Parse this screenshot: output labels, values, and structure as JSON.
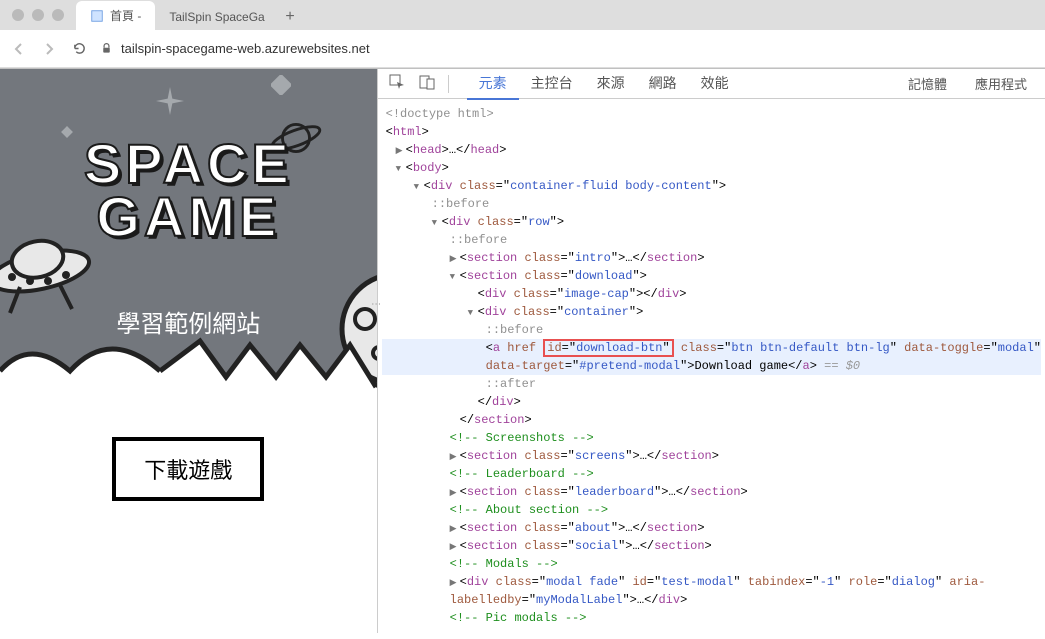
{
  "browser": {
    "tabs": [
      {
        "title": "首頁 -",
        "active": true
      },
      {
        "title": "TailSpin SpaceGa",
        "active": false
      }
    ],
    "url": "tailspin-spacegame-web.azurewebsites.net"
  },
  "page": {
    "title_line1": "SPACE",
    "title_line2": "GAME",
    "subtitle": "學習範例網站",
    "download_button": "下載遊戲"
  },
  "devtools": {
    "tabs": {
      "elements": "元素",
      "console": "主控台",
      "sources": "來源",
      "network": "網路",
      "performance": "效能",
      "memory": "記憶體",
      "application": "應用程式"
    },
    "dom": {
      "doctype": "<!doctype html>",
      "html_open": "html",
      "head": {
        "open": "head",
        "ellipsis": "…",
        "close": "head"
      },
      "body_open": "body",
      "container_div": {
        "tag": "div",
        "class_attr": "class",
        "class_val": "container-fluid body-content"
      },
      "before": "::before",
      "row_div": {
        "tag": "div",
        "class_attr": "class",
        "class_val": "row"
      },
      "intro": {
        "tag": "section",
        "class_attr": "class",
        "class_val": "intro",
        "ellipsis": "…"
      },
      "download": {
        "tag": "section",
        "class_attr": "class",
        "class_val": "download"
      },
      "image_cap": {
        "tag": "div",
        "class_attr": "class",
        "class_val": "image-cap"
      },
      "container": {
        "tag": "div",
        "class_attr": "class",
        "class_val": "container"
      },
      "anchor": {
        "tag": "a",
        "href_attr": "href",
        "id_attr": "id",
        "id_val": "download-btn",
        "class_attr": "class",
        "class_val": "btn btn-default btn-lg",
        "toggle_attr": "data-toggle",
        "toggle_val": "modal",
        "target_attr": "data-target",
        "target_val": "#pretend-modal",
        "text": "Download game",
        "selected": " == $0"
      },
      "after": "::after",
      "div_close": "div",
      "section_close": "section",
      "comment_screenshots": " Screenshots ",
      "screens": {
        "tag": "section",
        "class_attr": "class",
        "class_val": "screens",
        "ellipsis": "…"
      },
      "comment_leaderboard": " Leaderboard ",
      "leaderboard": {
        "tag": "section",
        "class_attr": "class",
        "class_val": "leaderboard",
        "ellipsis": "…"
      },
      "comment_about": " About section ",
      "about": {
        "tag": "section",
        "class_attr": "class",
        "class_val": "about",
        "ellipsis": "…"
      },
      "social": {
        "tag": "section",
        "class_attr": "class",
        "class_val": "social",
        "ellipsis": "…"
      },
      "comment_modals": " Modals ",
      "modal_div": {
        "tag": "div",
        "class_attr": "class",
        "class_val": "modal fade",
        "id_attr": "id",
        "id_val": "test-modal",
        "tabindex_attr": "tabindex",
        "tabindex_val": "-1",
        "role_attr": "role",
        "role_val": "dialog",
        "aria_attr": "aria-labelledby",
        "aria_val": "myModalLabel",
        "ellipsis": "…"
      },
      "comment_pic": " Pic modals "
    }
  }
}
